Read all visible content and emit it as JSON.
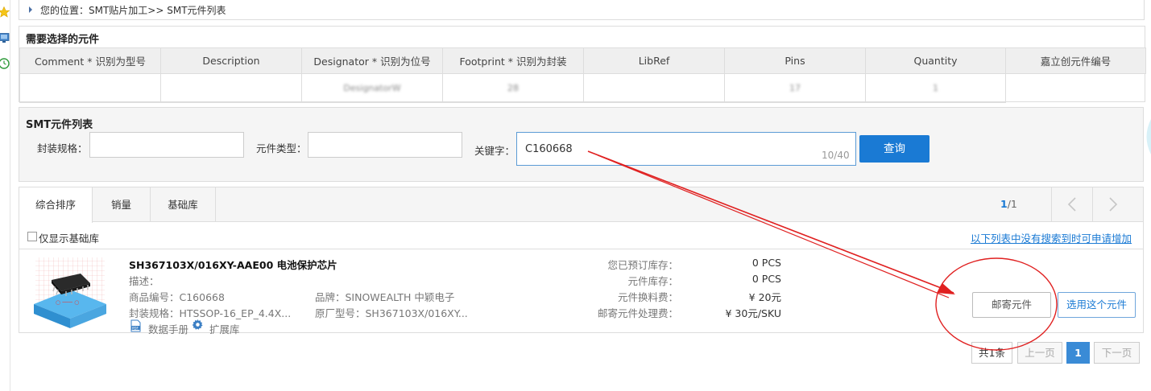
{
  "breadcrumb": {
    "text": "您的位置：SMT贴片加工>> SMT元件列表"
  },
  "required": {
    "title": "需要选择的元件",
    "columns": [
      "Comment * 识别为型号",
      "Description",
      "Designator * 识别为位号",
      "Footprint * 识别为封装",
      "LibRef",
      "Pins",
      "Quantity",
      "嘉立创元件编号"
    ],
    "row": [
      "",
      "",
      "DesignatorW",
      "28",
      "",
      "17",
      "1",
      ""
    ]
  },
  "search": {
    "title": "SMT元件列表",
    "package_label": "封装规格：",
    "package_value": "",
    "type_label": "元件类型：",
    "type_value": "",
    "keyword_label": "关键字：",
    "keyword_value": "C160668",
    "keyword_count": "10/40",
    "search_button": "查询"
  },
  "tabs": [
    {
      "label": "综合排序",
      "active": true
    },
    {
      "label": "销量",
      "active": false
    },
    {
      "label": "基础库",
      "active": false
    }
  ],
  "pager_top": {
    "current": "1",
    "total": "/1"
  },
  "filter": {
    "basic_only_label": "仅显示基础库",
    "apply_link": "以下列表中没有搜索到时可申请增加"
  },
  "item": {
    "title": "SH367103X/016XY-AAE00 电池保护芯片",
    "desc_label": "描述：",
    "part_no": "商品编号：C160668",
    "brand": "品牌：SINOWEALTH 中颖电子",
    "package": "封装规格：HTSSOP-16_EP_4.4X...",
    "mfr_part": "原厂型号：SH367103X/016XY...",
    "datasheet": "数据手册",
    "extlib": "扩展库",
    "stats": [
      {
        "label": "您已预订库存：",
        "value": "0 PCS"
      },
      {
        "label": "元件库存：",
        "value": "0 PCS"
      },
      {
        "label": "元件换料费：",
        "value": "¥ 20元"
      },
      {
        "label": "邮寄元件处理费：",
        "value": "¥ 30元/SKU"
      }
    ],
    "mail_button": "邮寄元件",
    "select_button": "选用这个元件"
  },
  "pagination": {
    "total": "共1条",
    "prev": "上一页",
    "current": "1",
    "next": "下一页"
  },
  "colors": {
    "accent": "#1a7ad4",
    "annotation": "#e02020",
    "header_bg": "#efefef"
  }
}
